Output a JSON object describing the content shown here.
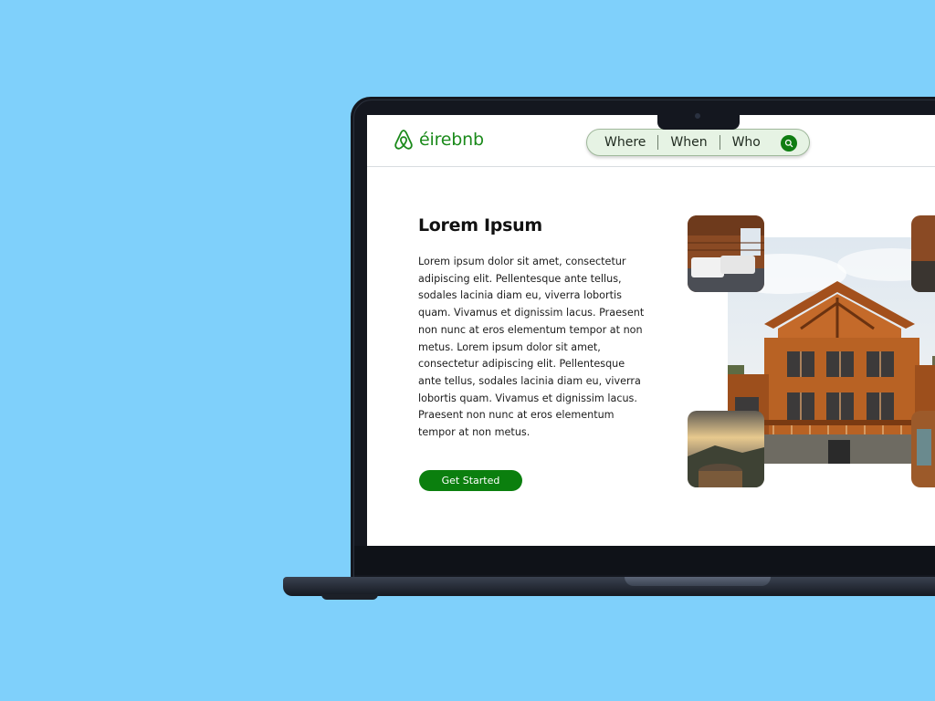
{
  "brand": {
    "name": "éirebnb",
    "color": "#1b8a1b",
    "logo_icon": "airbnb-belo-icon"
  },
  "search": {
    "where_label": "Where",
    "when_label": "When",
    "who_label": "Who",
    "icon": "search-icon",
    "pill_background": "#e6f3e4"
  },
  "hero": {
    "title": "Lorem Ipsum",
    "body": "Lorem ipsum dolor sit amet, consectetur adipiscing elit. Pellentesque ante tellus, sodales lacinia diam eu, viverra lobortis quam. Vivamus et dignissim lacus. Praesent non nunc at eros elementum tempor at non metus. Lorem ipsum dolor sit amet, consectetur adipiscing elit. Pellentesque ante tellus, sodales lacinia diam eu, viverra lobortis quam. Vivamus et dignissim lacus. Praesent non nunc at eros elementum tempor at non metus.",
    "cta_label": "Get Started",
    "cta_color": "#0b7f0e"
  },
  "images": {
    "main": "wooden-lodge-photo",
    "thumbnails": [
      "bedroom-photo",
      "hot-tub-sunset-photo",
      "interior-photo",
      "exterior-photo"
    ]
  },
  "colors": {
    "background": "#7fd0fb",
    "laptop": "#14171f"
  }
}
